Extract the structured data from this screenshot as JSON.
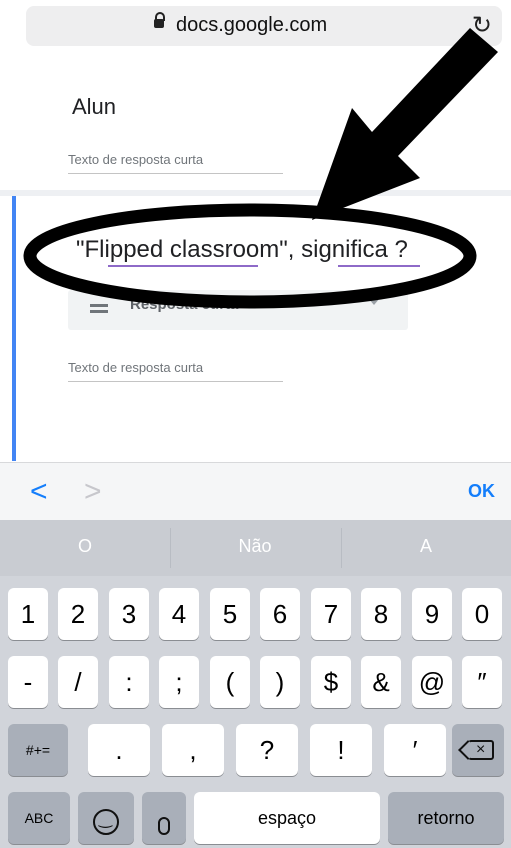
{
  "browser": {
    "url": "docs.google.com",
    "lock_icon": "lock-icon",
    "reload_icon": "reload-icon"
  },
  "form": {
    "question1": {
      "title": "Alun",
      "answer_placeholder": "Texto de resposta curta"
    },
    "question2": {
      "title": "\"Flipped classroom\", significa ?",
      "type_label": "Resposta curta",
      "answer_placeholder": "Texto de resposta curta"
    }
  },
  "accessory": {
    "prev": "<",
    "next": ">",
    "ok": "OK"
  },
  "keyboard": {
    "suggestions": [
      "O",
      "Não",
      "A"
    ],
    "row1": [
      "1",
      "2",
      "3",
      "4",
      "5",
      "6",
      "7",
      "8",
      "9",
      "0"
    ],
    "row2": [
      "-",
      "/",
      ":",
      ";",
      "(",
      ")",
      "$",
      "&",
      "@",
      "″"
    ],
    "row3_left": "#+=",
    "row3": [
      ".",
      ",",
      "?",
      "!",
      "′"
    ],
    "abc": "ABC",
    "space": "espaço",
    "return": "retorno"
  },
  "colors": {
    "accent_blue": "#147efb",
    "form_blue": "#4285f4",
    "underline_purple": "#8e6ac8"
  }
}
